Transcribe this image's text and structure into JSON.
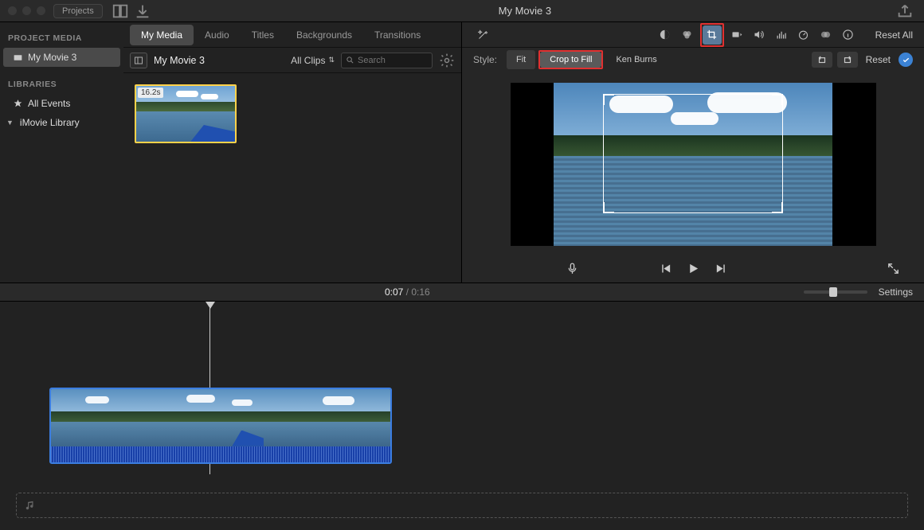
{
  "titlebar": {
    "projects_label": "Projects",
    "title": "My Movie 3"
  },
  "tabs": {
    "my_media": "My Media",
    "audio": "Audio",
    "titles": "Titles",
    "backgrounds": "Backgrounds",
    "transitions": "Transitions"
  },
  "sidebar": {
    "project_media_hdr": "PROJECT MEDIA",
    "project_name": "My Movie 3",
    "libraries_hdr": "LIBRARIES",
    "all_events": "All Events",
    "imovie_library": "iMovie Library"
  },
  "subbar": {
    "event_name": "My Movie 3",
    "clips_dd": "All Clips",
    "search_placeholder": "Search"
  },
  "thumb": {
    "duration": "16.2s"
  },
  "viewer_tools": {
    "reset_all": "Reset All"
  },
  "style": {
    "label": "Style:",
    "fit": "Fit",
    "crop_to_fill": "Crop to Fill",
    "ken_burns": "Ken Burns",
    "reset": "Reset"
  },
  "transport": {
    "current": "0:07",
    "duration": "0:16",
    "settings": "Settings"
  }
}
